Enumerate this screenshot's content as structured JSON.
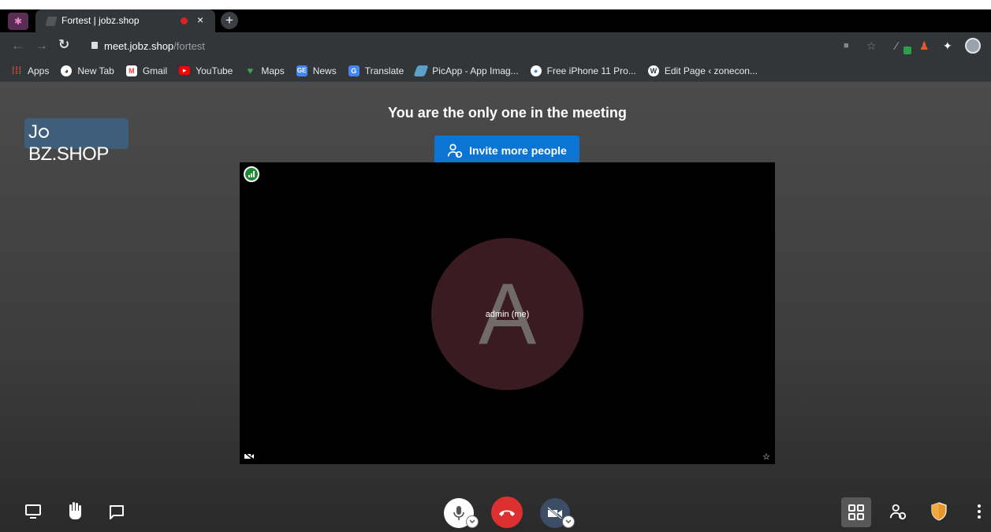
{
  "browser": {
    "tab_title": "Fortest | jobz.shop",
    "new_tab_symbol": "+",
    "close_symbol": "×",
    "url_host": "meet.jobz.shop",
    "url_path": "/fortest",
    "bookmarks": [
      {
        "label": "Apps",
        "icon": "apps-grid-icon",
        "color": "#e94235"
      },
      {
        "label": "New Tab",
        "icon": "globe-icon",
        "color": "#ffffff"
      },
      {
        "label": "Gmail",
        "icon": "gmail-icon",
        "color": "#ea4335"
      },
      {
        "label": "YouTube",
        "icon": "youtube-icon",
        "color": "#ff0000"
      },
      {
        "label": "Maps",
        "icon": "maps-pin-icon",
        "color": "#34a853"
      },
      {
        "label": "News",
        "icon": "google-news-icon",
        "color": "#4285f4"
      },
      {
        "label": "Translate",
        "icon": "translate-icon",
        "color": "#4285f4"
      },
      {
        "label": "PicApp - App Imag...",
        "icon": "picapp-icon",
        "color": "#5aa0c8"
      },
      {
        "label": "Free iPhone 11 Pro...",
        "icon": "iphone-site-icon",
        "color": "#3a8fd6"
      },
      {
        "label": "Edit Page ‹ zonecon...",
        "icon": "wordpress-icon",
        "color": "#ffffff"
      }
    ]
  },
  "meeting": {
    "logo_left": "J",
    "logo_right": "BZ.SHOP",
    "headline": "You are the only one in the meeting",
    "invite_label": "Invite more people",
    "participant_initial": "A",
    "participant_name": "admin (me)"
  },
  "colors": {
    "invite_blue": "#0b75d4",
    "hangup_red": "#dd3030",
    "signal_green": "#1e8a34",
    "shield_orange": "#e7962c"
  }
}
